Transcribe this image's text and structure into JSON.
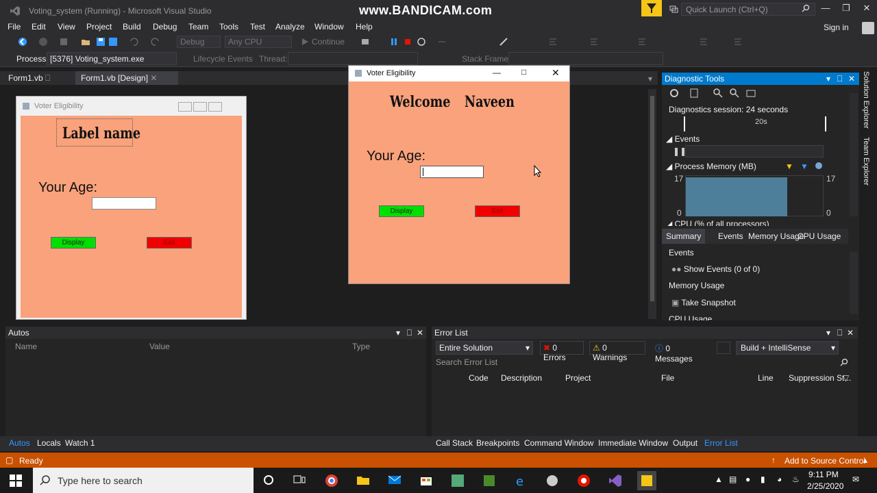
{
  "titlebar": {
    "title": "Voting_system (Running) - Microsoft Visual Studio",
    "watermark": "www.BANDICAM.com",
    "quick_launch": "Quick Launch (Ctrl+Q)"
  },
  "menu": [
    "File",
    "Edit",
    "View",
    "Project",
    "Build",
    "Debug",
    "Team",
    "Tools",
    "Test",
    "Analyze",
    "Window",
    "Help"
  ],
  "signin": "Sign in",
  "toolbar": {
    "config": "Debug",
    "platform": "Any CPU",
    "continue": "Continue"
  },
  "debugbar": {
    "process_label": "Process:",
    "process_value": "[5376] Voting_system.exe",
    "lifecycle": "Lifecycle Events",
    "thread": "Thread:",
    "stack_frame": "Stack Frame:"
  },
  "doctabs": [
    "Form1.vb",
    "Form1.vb [Design]"
  ],
  "design_form": {
    "title": "Voter Eligibility",
    "label_name": "Label  name",
    "age_label": "Your Age:",
    "display_btn": "Display",
    "exit_btn": "Exit"
  },
  "run_form": {
    "title": "Voter Eligibility",
    "welcome": "Welcome",
    "name": "Naveen",
    "age_label": "Your Age:",
    "display_btn": "Display",
    "exit_btn": "Exit"
  },
  "diag": {
    "title": "Diagnostic Tools",
    "session": "Diagnostics session: 24 seconds",
    "timeline_mark": "20s",
    "events": "Events",
    "process_memory": "Process Memory (MB)",
    "mem_max_left": "17",
    "mem_max_right": "17",
    "mem_min_left": "0",
    "mem_min_right": "0",
    "cpu": "CPU (% of all processors)",
    "tabs": [
      "Summary",
      "Events",
      "Memory Usage",
      "CPU Usage"
    ],
    "sec_events": "Events",
    "show_events": "Show Events (0 of 0)",
    "sec_memory": "Memory Usage",
    "take_snapshot": "Take Snapshot",
    "sec_cpu": "CPU Usage"
  },
  "side_tabs": [
    "Solution Explorer",
    "Team Explorer"
  ],
  "autos": {
    "title": "Autos",
    "cols": [
      "Name",
      "Value",
      "Type"
    ]
  },
  "errlist": {
    "title": "Error List",
    "scope": "Entire Solution",
    "errors": "0 Errors",
    "warnings": "0 Warnings",
    "messages": "0 Messages",
    "build": "Build + IntelliSense",
    "search": "Search Error List",
    "cols": [
      "Code",
      "Description",
      "Project",
      "File",
      "Line",
      "Suppression St..."
    ]
  },
  "bottom_tabs_left": [
    "Autos",
    "Locals",
    "Watch 1"
  ],
  "bottom_tabs_right": [
    "Call Stack",
    "Breakpoints",
    "Command Window",
    "Immediate Window",
    "Output",
    "Error List"
  ],
  "status": {
    "ready": "Ready",
    "source_control": "Add to Source Control"
  },
  "taskbar": {
    "search_placeholder": "Type here to search",
    "time": "9:11 PM",
    "date": "2/25/2020"
  },
  "colors": {
    "accent": "#007acc",
    "status": "#ca5100",
    "form_bg": "#f9a27c",
    "display_btn": "#00e000",
    "exit_btn": "#f00000"
  }
}
